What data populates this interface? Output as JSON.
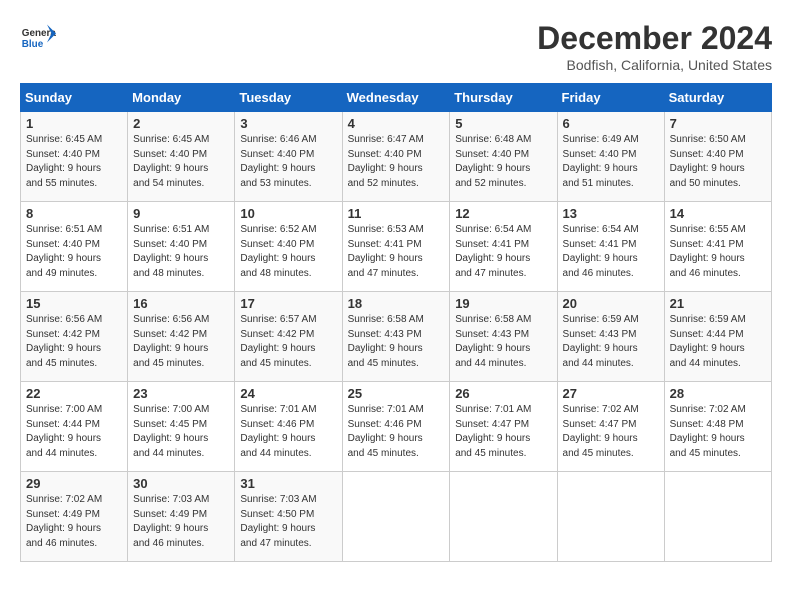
{
  "logo": {
    "line1": "General",
    "line2": "Blue"
  },
  "title": "December 2024",
  "location": "Bodfish, California, United States",
  "days_of_week": [
    "Sunday",
    "Monday",
    "Tuesday",
    "Wednesday",
    "Thursday",
    "Friday",
    "Saturday"
  ],
  "weeks": [
    [
      {
        "day": "1",
        "info": "Sunrise: 6:45 AM\nSunset: 4:40 PM\nDaylight: 9 hours\nand 55 minutes."
      },
      {
        "day": "2",
        "info": "Sunrise: 6:45 AM\nSunset: 4:40 PM\nDaylight: 9 hours\nand 54 minutes."
      },
      {
        "day": "3",
        "info": "Sunrise: 6:46 AM\nSunset: 4:40 PM\nDaylight: 9 hours\nand 53 minutes."
      },
      {
        "day": "4",
        "info": "Sunrise: 6:47 AM\nSunset: 4:40 PM\nDaylight: 9 hours\nand 52 minutes."
      },
      {
        "day": "5",
        "info": "Sunrise: 6:48 AM\nSunset: 4:40 PM\nDaylight: 9 hours\nand 52 minutes."
      },
      {
        "day": "6",
        "info": "Sunrise: 6:49 AM\nSunset: 4:40 PM\nDaylight: 9 hours\nand 51 minutes."
      },
      {
        "day": "7",
        "info": "Sunrise: 6:50 AM\nSunset: 4:40 PM\nDaylight: 9 hours\nand 50 minutes."
      }
    ],
    [
      {
        "day": "8",
        "info": "Sunrise: 6:51 AM\nSunset: 4:40 PM\nDaylight: 9 hours\nand 49 minutes."
      },
      {
        "day": "9",
        "info": "Sunrise: 6:51 AM\nSunset: 4:40 PM\nDaylight: 9 hours\nand 48 minutes."
      },
      {
        "day": "10",
        "info": "Sunrise: 6:52 AM\nSunset: 4:40 PM\nDaylight: 9 hours\nand 48 minutes."
      },
      {
        "day": "11",
        "info": "Sunrise: 6:53 AM\nSunset: 4:41 PM\nDaylight: 9 hours\nand 47 minutes."
      },
      {
        "day": "12",
        "info": "Sunrise: 6:54 AM\nSunset: 4:41 PM\nDaylight: 9 hours\nand 47 minutes."
      },
      {
        "day": "13",
        "info": "Sunrise: 6:54 AM\nSunset: 4:41 PM\nDaylight: 9 hours\nand 46 minutes."
      },
      {
        "day": "14",
        "info": "Sunrise: 6:55 AM\nSunset: 4:41 PM\nDaylight: 9 hours\nand 46 minutes."
      }
    ],
    [
      {
        "day": "15",
        "info": "Sunrise: 6:56 AM\nSunset: 4:42 PM\nDaylight: 9 hours\nand 45 minutes."
      },
      {
        "day": "16",
        "info": "Sunrise: 6:56 AM\nSunset: 4:42 PM\nDaylight: 9 hours\nand 45 minutes."
      },
      {
        "day": "17",
        "info": "Sunrise: 6:57 AM\nSunset: 4:42 PM\nDaylight: 9 hours\nand 45 minutes."
      },
      {
        "day": "18",
        "info": "Sunrise: 6:58 AM\nSunset: 4:43 PM\nDaylight: 9 hours\nand 45 minutes."
      },
      {
        "day": "19",
        "info": "Sunrise: 6:58 AM\nSunset: 4:43 PM\nDaylight: 9 hours\nand 44 minutes."
      },
      {
        "day": "20",
        "info": "Sunrise: 6:59 AM\nSunset: 4:43 PM\nDaylight: 9 hours\nand 44 minutes."
      },
      {
        "day": "21",
        "info": "Sunrise: 6:59 AM\nSunset: 4:44 PM\nDaylight: 9 hours\nand 44 minutes."
      }
    ],
    [
      {
        "day": "22",
        "info": "Sunrise: 7:00 AM\nSunset: 4:44 PM\nDaylight: 9 hours\nand 44 minutes."
      },
      {
        "day": "23",
        "info": "Sunrise: 7:00 AM\nSunset: 4:45 PM\nDaylight: 9 hours\nand 44 minutes."
      },
      {
        "day": "24",
        "info": "Sunrise: 7:01 AM\nSunset: 4:46 PM\nDaylight: 9 hours\nand 44 minutes."
      },
      {
        "day": "25",
        "info": "Sunrise: 7:01 AM\nSunset: 4:46 PM\nDaylight: 9 hours\nand 45 minutes."
      },
      {
        "day": "26",
        "info": "Sunrise: 7:01 AM\nSunset: 4:47 PM\nDaylight: 9 hours\nand 45 minutes."
      },
      {
        "day": "27",
        "info": "Sunrise: 7:02 AM\nSunset: 4:47 PM\nDaylight: 9 hours\nand 45 minutes."
      },
      {
        "day": "28",
        "info": "Sunrise: 7:02 AM\nSunset: 4:48 PM\nDaylight: 9 hours\nand 45 minutes."
      }
    ],
    [
      {
        "day": "29",
        "info": "Sunrise: 7:02 AM\nSunset: 4:49 PM\nDaylight: 9 hours\nand 46 minutes."
      },
      {
        "day": "30",
        "info": "Sunrise: 7:03 AM\nSunset: 4:49 PM\nDaylight: 9 hours\nand 46 minutes."
      },
      {
        "day": "31",
        "info": "Sunrise: 7:03 AM\nSunset: 4:50 PM\nDaylight: 9 hours\nand 47 minutes."
      },
      {
        "day": "",
        "info": ""
      },
      {
        "day": "",
        "info": ""
      },
      {
        "day": "",
        "info": ""
      },
      {
        "day": "",
        "info": ""
      }
    ]
  ]
}
